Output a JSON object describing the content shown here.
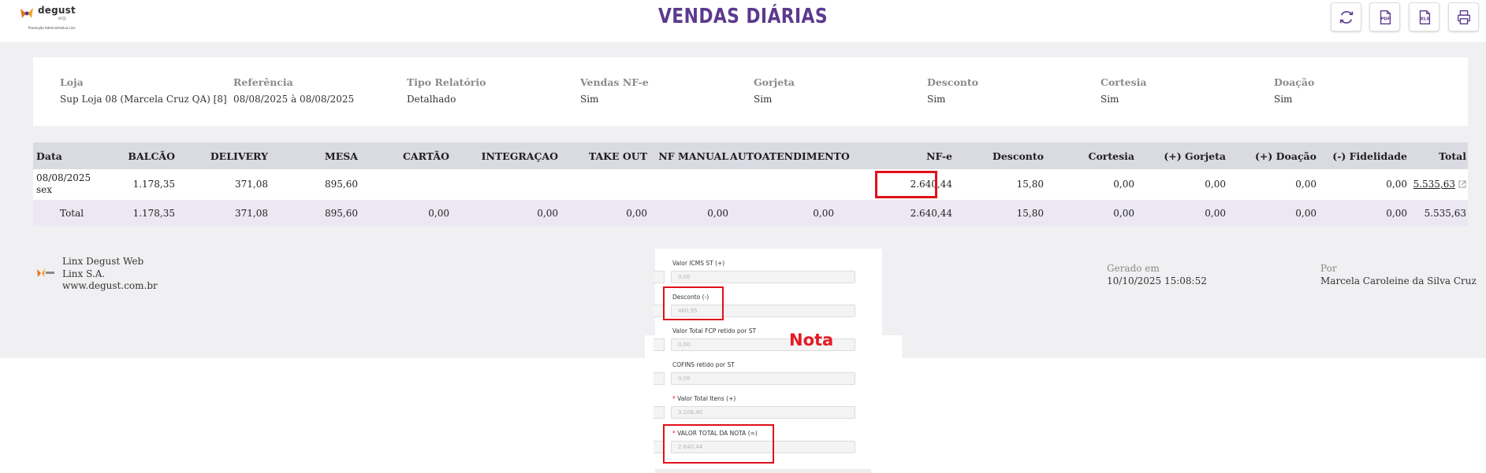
{
  "header": {
    "logo": {
      "name": "degust",
      "sub": "erp",
      "tagline": "Promoção Administrativa Linx"
    },
    "title": "VENDAS DIÁRIAS",
    "tools": [
      {
        "name": "refresh-icon"
      },
      {
        "name": "pdf-icon"
      },
      {
        "name": "xls-icon"
      },
      {
        "name": "print-icon"
      }
    ]
  },
  "filters": [
    {
      "label": "Loja",
      "value": "Sup Loja 08 (Marcela Cruz QA) [8]"
    },
    {
      "label": "Referência",
      "value": "08/08/2025 à 08/08/2025"
    },
    {
      "label": "Tipo Relatório",
      "value": "Detalhado"
    },
    {
      "label": "Vendas NF-e",
      "value": "Sim"
    },
    {
      "label": "Gorjeta",
      "value": "Sim"
    },
    {
      "label": "Desconto",
      "value": "Sim"
    },
    {
      "label": "Cortesia",
      "value": "Sim"
    },
    {
      "label": "Doação",
      "value": "Sim"
    }
  ],
  "table": {
    "columns": [
      "Data",
      "BALCÃO",
      "DELIVERY",
      "MESA",
      "CARTÃO",
      "INTEGRAÇAO",
      "TAKE OUT",
      "NF MANUAL",
      "AUTOATENDIMENTO",
      "NF-e",
      "Desconto",
      "Cortesia",
      "(+) Gorjeta",
      "(+) Doação",
      "(-) Fidelidade",
      "Total"
    ],
    "rows": [
      {
        "date": "08/08/2025",
        "weekday": "sex",
        "balcao": "1.178,35",
        "delivery": "371,08",
        "mesa": "895,60",
        "cartao": "",
        "integracao": "",
        "takeout": "",
        "nfmanual": "",
        "autoatendimento": "",
        "nfe": "2.640,44",
        "desconto": "15,80",
        "cortesia": "0,00",
        "gorjeta": "0,00",
        "doacao": "0,00",
        "fidelidade": "0,00",
        "total": "5.535,63"
      }
    ],
    "totals": {
      "label": "Total",
      "balcao": "1.178,35",
      "delivery": "371,08",
      "mesa": "895,60",
      "cartao": "0,00",
      "integracao": "0,00",
      "takeout": "0,00",
      "nfmanual": "0,00",
      "autoatendimento": "0,00",
      "nfe": "2.640,44",
      "desconto": "15,80",
      "cortesia": "0,00",
      "gorjeta": "0,00",
      "doacao": "0,00",
      "fidelidade": "0,00",
      "total": "5.535,63"
    }
  },
  "footer": {
    "company_lines": [
      "Linx Degust Web",
      "Linx S.A.",
      "www.degust.com.br"
    ],
    "generated_label": "Gerado em",
    "generated_value": "10/10/2025 15:08:52",
    "by_label": "Por",
    "by_value": "Marcela Caroleine da Silva Cruz"
  },
  "overlay": {
    "fields": [
      {
        "label": "Valor ICMS ST (+)",
        "value": "0,00",
        "required": false
      },
      {
        "label": "Desconto (-)",
        "value": "460,95",
        "required": false
      },
      {
        "label": "Valor Total FCP retido por ST",
        "value": "0,00",
        "required": false
      },
      {
        "label": "COFINS retido por ST",
        "value": "0,00",
        "required": false
      },
      {
        "label": "Valor Total Itens (+)",
        "value": "3.106,40",
        "required": true
      },
      {
        "label": "VALOR TOTAL DA NOTA (=)",
        "value": "2.640,44",
        "required": true
      }
    ],
    "annotation": "Nota",
    "required_mark": "*"
  },
  "colors": {
    "title": "#5b3a8e",
    "header_row": "#dadae3",
    "total_row": "#ebe7f3",
    "highlight": "#e0101a",
    "backdrop": "#f0f0f2"
  }
}
